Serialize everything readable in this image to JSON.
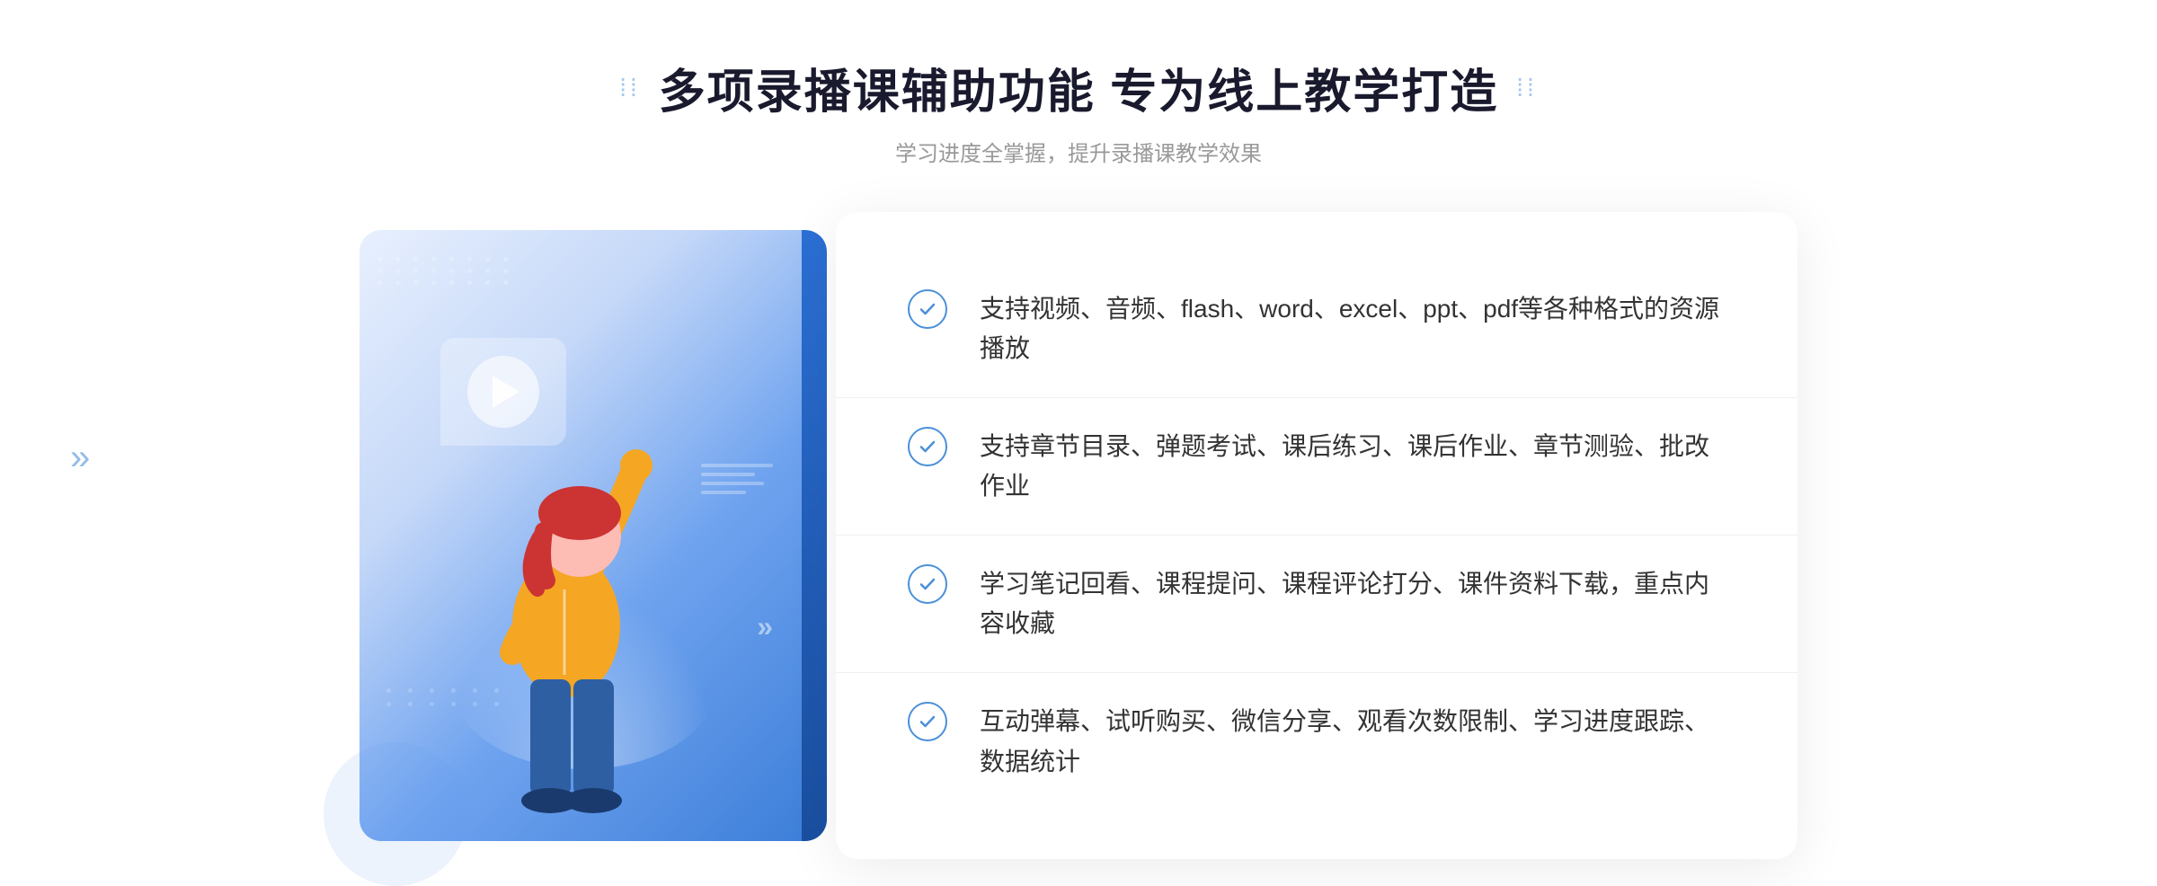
{
  "page": {
    "background": "#ffffff"
  },
  "header": {
    "title_dots_left": "⁞⁞",
    "title_dots_right": "⁞⁞",
    "main_title": "多项录播课辅助功能 专为线上教学打造",
    "sub_title": "学习进度全掌握，提升录播课教学效果"
  },
  "features": [
    {
      "id": 1,
      "text": "支持视频、音频、flash、word、excel、ppt、pdf等各种格式的资源播放"
    },
    {
      "id": 2,
      "text": "支持章节目录、弹题考试、课后练习、课后作业、章节测验、批改作业"
    },
    {
      "id": 3,
      "text": "学习笔记回看、课程提问、课程评论打分、课件资料下载，重点内容收藏"
    },
    {
      "id": 4,
      "text": "互动弹幕、试听购买、微信分享、观看次数限制、学习进度跟踪、数据统计"
    }
  ],
  "colors": {
    "accent": "#4a90d9",
    "dark_blue": "#1a4fa0",
    "text_dark": "#333333",
    "text_gray": "#999999",
    "bg_white": "#ffffff",
    "gradient_start": "#e8f0fe",
    "gradient_end": "#3b7dd8"
  },
  "decoration": {
    "arrow_symbol": "»",
    "play_available": true
  }
}
